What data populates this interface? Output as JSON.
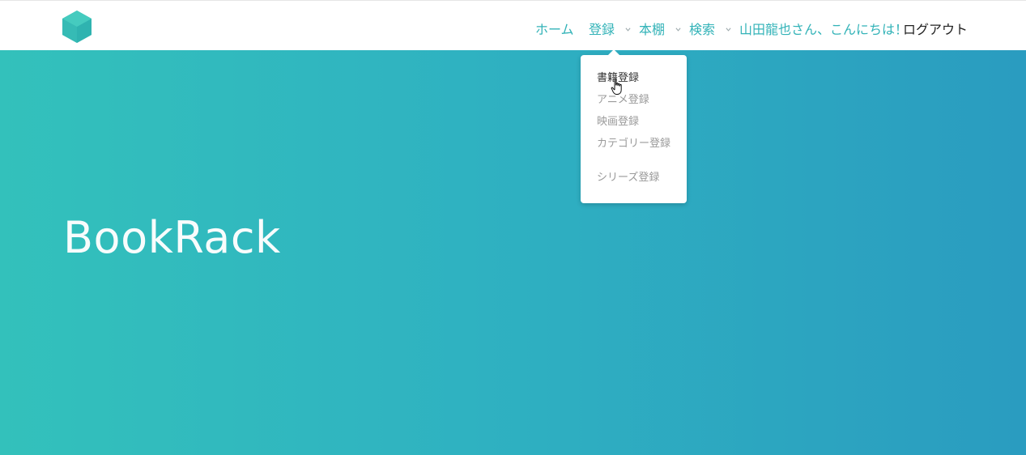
{
  "header": {
    "logo_icon": "hexagon-cube-logo-icon",
    "nav": {
      "home": "ホーム",
      "register": "登録",
      "bookshelf": "本棚",
      "search": "検索",
      "greeting": "山田龍也さん、こんにちは！",
      "logout": "ログアウト"
    }
  },
  "dropdown": {
    "items": [
      {
        "label": "書籍登録"
      },
      {
        "label": "アニメ登録"
      },
      {
        "label": "映画登録"
      },
      {
        "label": "カテゴリー登録"
      },
      {
        "label": "シリーズ登録"
      }
    ]
  },
  "hero": {
    "title": "BookRack"
  },
  "colors": {
    "accent": "#33b3b8",
    "hero_start": "#33c1bb",
    "hero_end": "#2a9cc0",
    "menu_text": "#9a9a9a"
  }
}
